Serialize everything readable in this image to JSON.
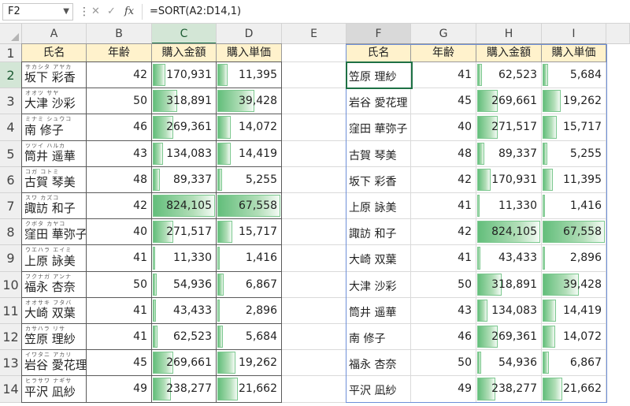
{
  "formula_bar": {
    "name_box": "F2",
    "fx_label": "fx",
    "formula": "=SORT(A2:D14,1)",
    "cancel_icon": "close-icon",
    "enter_icon": "checkmark-icon"
  },
  "columns": [
    "A",
    "B",
    "C",
    "D",
    "E",
    "F",
    "G",
    "H",
    "I"
  ],
  "rows": [
    "1",
    "2",
    "3",
    "4",
    "5",
    "6",
    "7",
    "8",
    "9",
    "10",
    "11",
    "12",
    "13",
    "14"
  ],
  "headers": [
    "氏名",
    "年齢",
    "購入金額",
    "購入単価"
  ],
  "source_table": [
    {
      "furigana": "サカシタ アヤカ",
      "name": "坂下 彩香",
      "age": "42",
      "amount": "170,931",
      "unit": "11,395"
    },
    {
      "furigana": "オオツ サヤ",
      "name": "大津 沙彩",
      "age": "50",
      "amount": "318,891",
      "unit": "39,428"
    },
    {
      "furigana": "ミナミ シュウコ",
      "name": "南 修子",
      "age": "46",
      "amount": "269,361",
      "unit": "14,072"
    },
    {
      "furigana": "ツツイ ハルカ",
      "name": "筒井 遥華",
      "age": "43",
      "amount": "134,083",
      "unit": "14,419"
    },
    {
      "furigana": "コガ コトミ",
      "name": "古賀 琴美",
      "age": "48",
      "amount": "89,337",
      "unit": "5,255"
    },
    {
      "furigana": "スワ カズコ",
      "name": "諏訪 和子",
      "age": "42",
      "amount": "824,105",
      "unit": "67,558"
    },
    {
      "furigana": "クボタ カヤコ",
      "name": "窪田 華弥子",
      "age": "40",
      "amount": "271,517",
      "unit": "15,717"
    },
    {
      "furigana": "ウエハラ エイミ",
      "name": "上原 詠美",
      "age": "41",
      "amount": "11,330",
      "unit": "1,416"
    },
    {
      "furigana": "フクナガ アンナ",
      "name": "福永 杏奈",
      "age": "50",
      "amount": "54,936",
      "unit": "6,867"
    },
    {
      "furigana": "オオサキ フタバ",
      "name": "大崎 双葉",
      "age": "41",
      "amount": "43,433",
      "unit": "2,896"
    },
    {
      "furigana": "カサハラ リサ",
      "name": "笠原 理紗",
      "age": "41",
      "amount": "62,523",
      "unit": "5,684"
    },
    {
      "furigana": "イワタニ アカリ",
      "name": "岩谷 愛花理",
      "age": "45",
      "amount": "269,661",
      "unit": "19,262"
    },
    {
      "furigana": "ヒラサワ ナギサ",
      "name": "平沢 凪紗",
      "age": "49",
      "amount": "238,277",
      "unit": "21,662"
    }
  ],
  "sorted_table": [
    {
      "name": "笠原 理紗",
      "age": "41",
      "amount": "62,523",
      "unit": "5,684"
    },
    {
      "name": "岩谷 愛花理",
      "age": "45",
      "amount": "269,661",
      "unit": "19,262"
    },
    {
      "name": "窪田 華弥子",
      "age": "40",
      "amount": "271,517",
      "unit": "15,717"
    },
    {
      "name": "古賀 琴美",
      "age": "48",
      "amount": "89,337",
      "unit": "5,255"
    },
    {
      "name": "坂下 彩香",
      "age": "42",
      "amount": "170,931",
      "unit": "11,395"
    },
    {
      "name": "上原 詠美",
      "age": "41",
      "amount": "11,330",
      "unit": "1,416"
    },
    {
      "name": "諏訪 和子",
      "age": "42",
      "amount": "824,105",
      "unit": "67,558"
    },
    {
      "name": "大崎 双葉",
      "age": "41",
      "amount": "43,433",
      "unit": "2,896"
    },
    {
      "name": "大津 沙彩",
      "age": "50",
      "amount": "318,891",
      "unit": "39,428"
    },
    {
      "name": "筒井 遥華",
      "age": "43",
      "amount": "134,083",
      "unit": "14,419"
    },
    {
      "name": "南 修子",
      "age": "46",
      "amount": "269,361",
      "unit": "14,072"
    },
    {
      "name": "福永 杏奈",
      "age": "50",
      "amount": "54,936",
      "unit": "6,867"
    },
    {
      "name": "平沢 凪紗",
      "age": "49",
      "amount": "238,277",
      "unit": "21,662"
    }
  ],
  "colors": {
    "header_fill": "#fff2cc",
    "databar": "#63be7b",
    "selection": "#1e7145",
    "spill_border": "#6e8fd8"
  }
}
